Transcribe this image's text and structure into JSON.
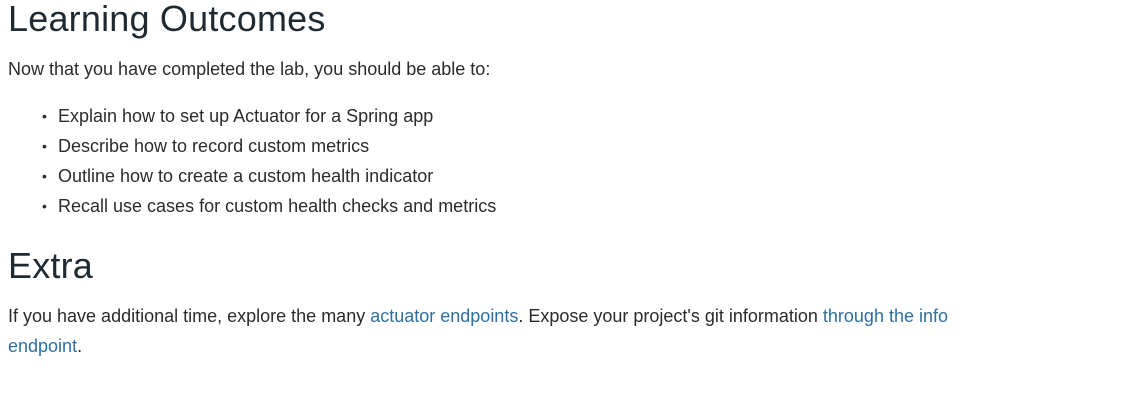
{
  "sections": {
    "learning_outcomes": {
      "heading": "Learning Outcomes",
      "intro": "Now that you have completed the lab, you should be able to:",
      "items": [
        "Explain how to set up Actuator for a Spring app",
        "Describe how to record custom metrics",
        "Outline how to create a custom health indicator",
        "Recall use cases for custom health checks and metrics"
      ]
    },
    "extra": {
      "heading": "Extra",
      "text_1": "If you have additional time, explore the many ",
      "link_1": "actuator endpoints",
      "text_2": ". Expose your project's git information ",
      "link_2": "through the info endpoint",
      "text_3": "."
    }
  },
  "colors": {
    "heading": "#1f2a33",
    "body_text": "#2b2b2b",
    "link": "#2f6f9f",
    "background": "#ffffff"
  },
  "icons": {
    "bullet": "•"
  }
}
